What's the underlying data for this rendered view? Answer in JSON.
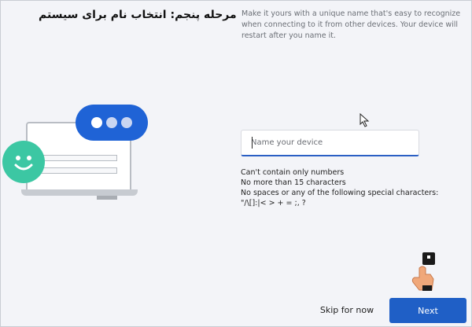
{
  "caption": "مرحله پنجم: انتخاب نام برای سیستم",
  "description": "Make it yours with a unique name that's easy to recognize when connecting to it from other devices. Your device will restart after you name it.",
  "name_input": {
    "placeholder": "Name your device",
    "value": ""
  },
  "rules": [
    "Can't contain only numbers",
    "No more than 15 characters",
    "No spaces or any of the following special characters:",
    "\"/\\[]:|< > + = ;, ?"
  ],
  "buttons": {
    "skip": "Skip for now",
    "next": "Next"
  },
  "colors": {
    "accent": "#1f5fc6",
    "bubble": "#1f63d6",
    "smiley": "#3cc7a3",
    "background": "#f3f4f8"
  },
  "icons": [
    "mouse-pointer-icon",
    "pointing-hand-icon",
    "smiley-face-icon",
    "chat-bubble-icon"
  ]
}
